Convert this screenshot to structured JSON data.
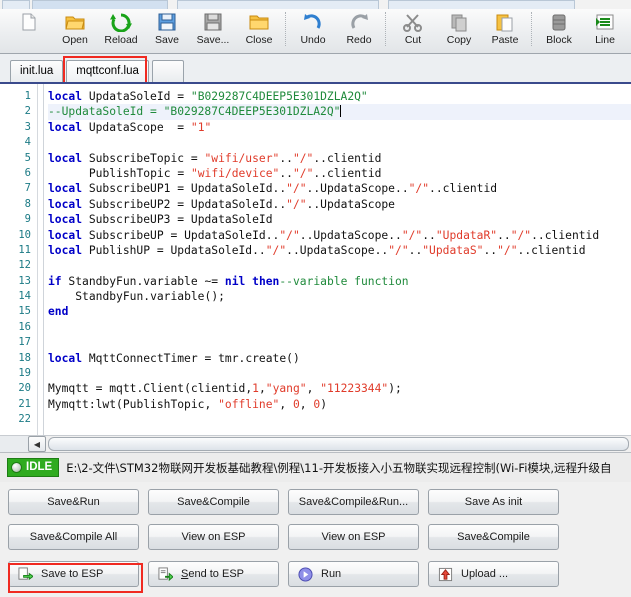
{
  "toolbar": {
    "items": [
      {
        "label": "",
        "icon": "new-file-icon"
      },
      {
        "label": "Open",
        "icon": "open-folder-icon"
      },
      {
        "label": "Reload",
        "icon": "reload-icon"
      },
      {
        "label": "Save",
        "icon": "save-disk-icon"
      },
      {
        "label": "Save...",
        "icon": "save-as-icon"
      },
      {
        "label": "Close",
        "icon": "close-folder-icon"
      },
      {
        "label": "Undo",
        "icon": "undo-arrow-icon"
      },
      {
        "label": "Redo",
        "icon": "redo-arrow-icon"
      },
      {
        "label": "Cut",
        "icon": "scissors-icon"
      },
      {
        "label": "Copy",
        "icon": "copy-icon"
      },
      {
        "label": "Paste",
        "icon": "paste-clipboard-icon"
      },
      {
        "label": "Block",
        "icon": "block-icon"
      },
      {
        "label": "Line",
        "icon": "line-icon"
      }
    ]
  },
  "tabs": [
    {
      "label": "init.lua",
      "active": false
    },
    {
      "label": "mqttconf.lua",
      "active": true
    }
  ],
  "editor": {
    "line_count": 22,
    "cursor_line": 2,
    "line_numbers": [
      "1",
      "2",
      "3",
      "4",
      "5",
      "6",
      "7",
      "8",
      "9",
      "10",
      "11",
      "12",
      "13",
      "14",
      "15",
      "16",
      "17",
      "18",
      "19",
      "20",
      "21",
      "22"
    ],
    "lines": [
      "local UpdataSoleId = \"B029287C4DEEP5E301DZLA2Q\"",
      "--UpdataSoleId = \"B029287C4DEEP5E301DZLA2Q\"",
      "local UpdataScope  = \"1\"",
      "",
      "local SubscribeTopic = \"wifi/user\"..\"/\"..clientid",
      "      PublishTopic = \"wifi/device\"..\"/\"..clientid",
      "local SubscribeUP1 = UpdataSoleId..\"/\"..UpdataScope..\"/\"..clientid",
      "local SubscribeUP2 = UpdataSoleId..\"/\"..UpdataScope",
      "local SubscribeUP3 = UpdataSoleId",
      "local SubscribeUP = UpdataSoleId..\"/\"..UpdataScope..\"/\"..\"UpdataR\"..\"/\"..clientid",
      "local PublishUP = UpdataSoleId..\"/\"..UpdataScope..\"/\"..\"UpdataS\"..\"/\"..clientid",
      "",
      "if StandbyFun.variable ~= nil then--variable function",
      "    StandbyFun.variable();",
      "end",
      "",
      "",
      "local MqttConnectTimer = tmr.create()",
      "",
      "Mymqtt = mqtt.Client(clientid,1,\"yang\", \"11223344\");",
      "Mymqtt:lwt(PublishTopic, \"offline\", 0, 0)",
      ""
    ]
  },
  "status": {
    "badge": "IDLE",
    "badge_color": "#2fab1f",
    "path": "E:\\2-文件\\STM32物联网开发板基础教程\\例程\\11-开发板接入小五物联实现远程控制(Wi-Fi模块,远程升级自"
  },
  "buttons": {
    "row1": [
      "Save&Run",
      "Save&Compile",
      "Save&Compile&Run...",
      "Save As init"
    ],
    "row2": [
      "Save&Compile All",
      "View on ESP",
      "View on ESP",
      "Save&Compile"
    ],
    "row3": [
      {
        "label": "Save to ESP",
        "icon": "save-to-esp-icon",
        "highlighted": true
      },
      {
        "label": "Send to ESP",
        "icon": "send-to-esp-icon",
        "highlighted": false
      },
      {
        "label": "Run",
        "icon": "run-play-icon",
        "highlighted": false
      },
      {
        "label": "Upload ...",
        "icon": "upload-arrow-icon",
        "highlighted": false
      }
    ]
  },
  "colors": {
    "highlight_red": "#f02a21",
    "keyword_blue": "#0000c8",
    "string_red": "#e03b2a",
    "comment_green": "#1f8a3b",
    "linenumber_teal": "#1b7a85"
  }
}
